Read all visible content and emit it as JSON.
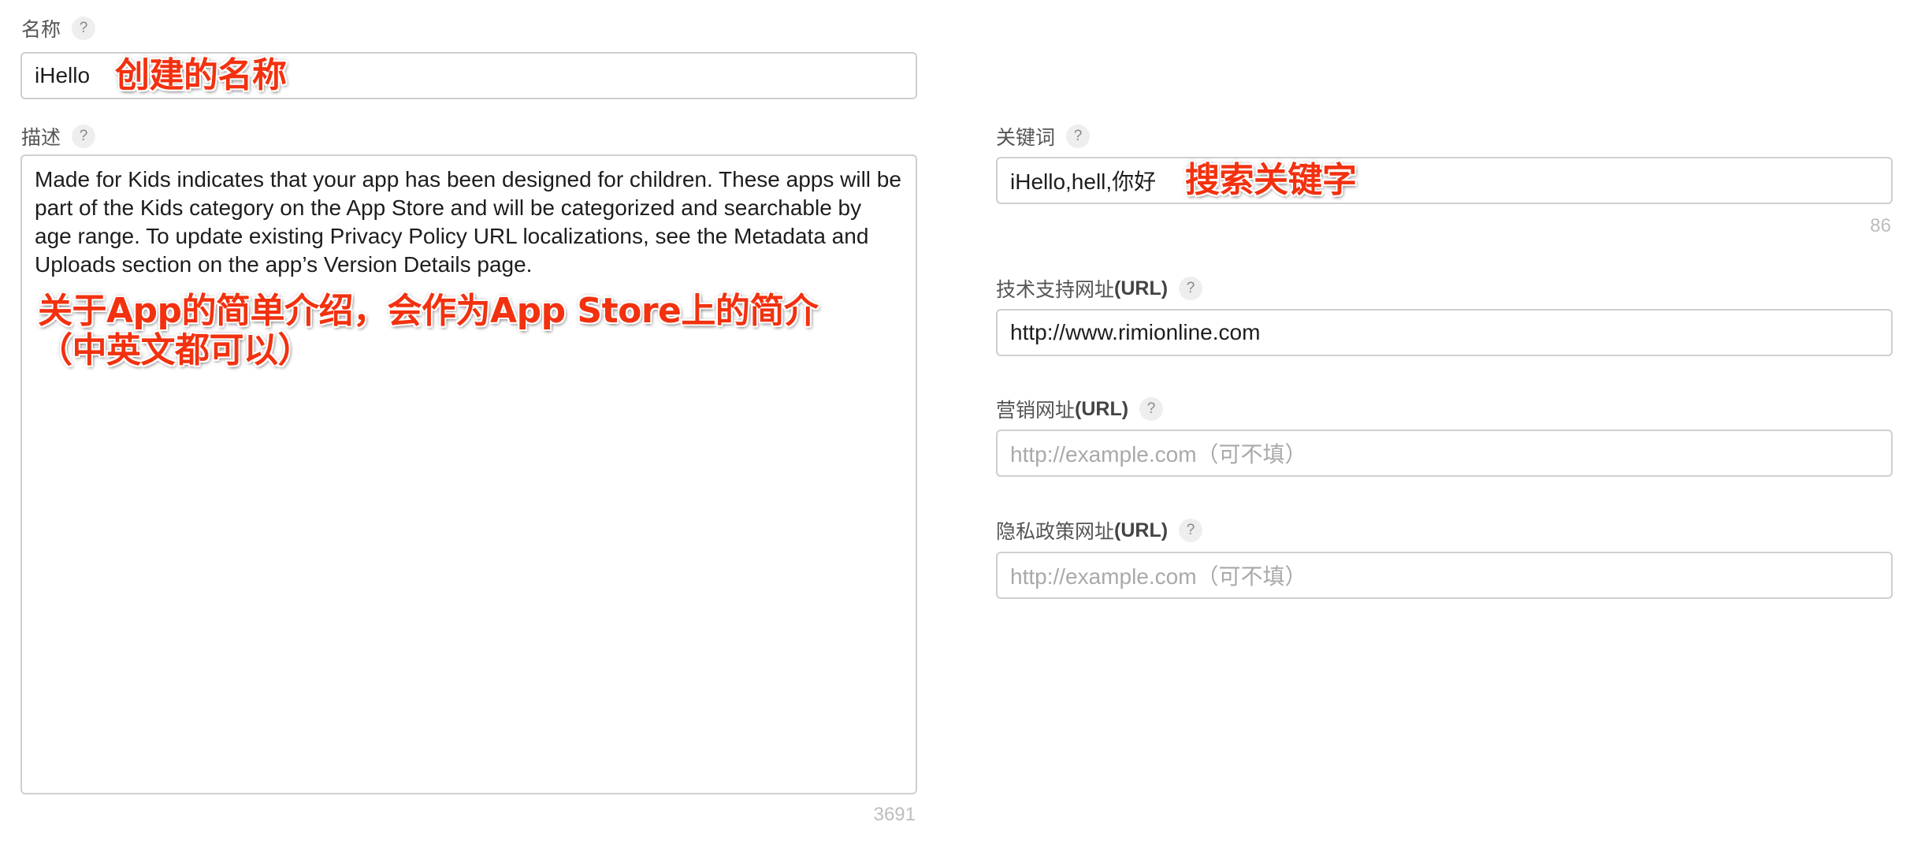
{
  "name_field": {
    "label": "名称",
    "help": "?",
    "value": "iHello",
    "annotation": "创建的名称"
  },
  "description_field": {
    "label": "描述",
    "help": "?",
    "value": "Made for Kids indicates that your app has been designed for children. These apps will be part of the Kids category on the App Store and will be categorized and searchable by age range. To update existing Privacy Policy URL localizations, see the Metadata and Uploads section on the app’s Version Details page.",
    "counter": "3691",
    "annotation_line1": "关于App的简单介绍，会作为App Store上的简介",
    "annotation_line2": "（中英文都可以）"
  },
  "keywords_field": {
    "label": "关键词",
    "help": "?",
    "value": "iHello,hell,你好",
    "counter": "86",
    "annotation": "搜索关键字"
  },
  "support_url_field": {
    "label_cn": "技术支持网址",
    "label_en": "(URL)",
    "help": "?",
    "value": "http://www.rimionline.com"
  },
  "marketing_url_field": {
    "label_cn": "营销网址",
    "label_en": "(URL)",
    "help": "?",
    "placeholder": "http://example.com（可不填）"
  },
  "privacy_url_field": {
    "label_cn": "隐私政策网址",
    "label_en": "(URL)",
    "help": "?",
    "placeholder": "http://example.com（可不填）"
  }
}
